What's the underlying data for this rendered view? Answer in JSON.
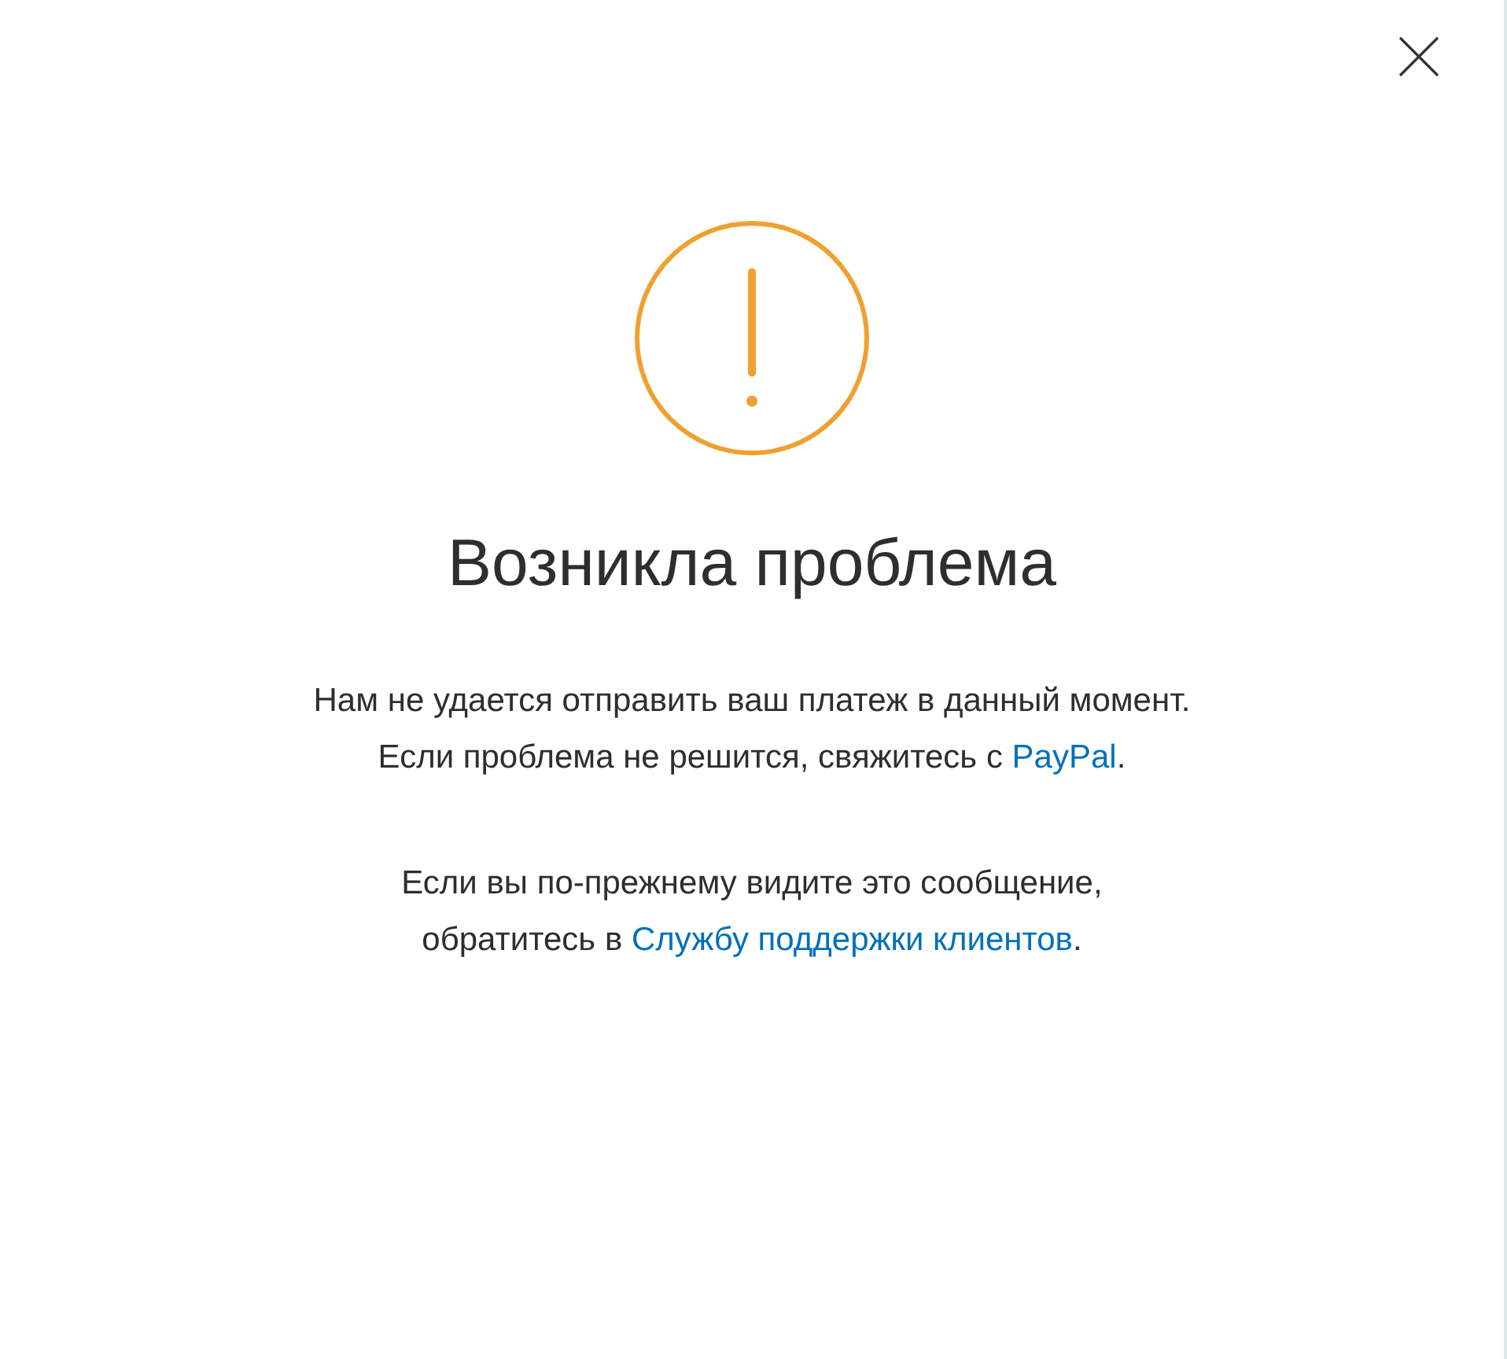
{
  "title": "Возникла проблема",
  "paragraphs": [
    {
      "lines": [
        [
          {
            "kind": "text",
            "text": "Нам не удается отправить ваш платеж в данный момент."
          }
        ],
        [
          {
            "kind": "text",
            "text": "Если проблема не решится, свяжитесь с "
          },
          {
            "kind": "link",
            "text": "PayPal"
          },
          {
            "kind": "text",
            "text": "."
          }
        ]
      ]
    },
    {
      "lines": [
        [
          {
            "kind": "text",
            "text": "Если вы по-прежнему видите это сообщение,"
          }
        ],
        [
          {
            "kind": "text",
            "text": "обратитесь в "
          },
          {
            "kind": "link",
            "text": "Службу поддержки клиентов"
          },
          {
            "kind": "text",
            "text": "."
          }
        ]
      ]
    }
  ]
}
